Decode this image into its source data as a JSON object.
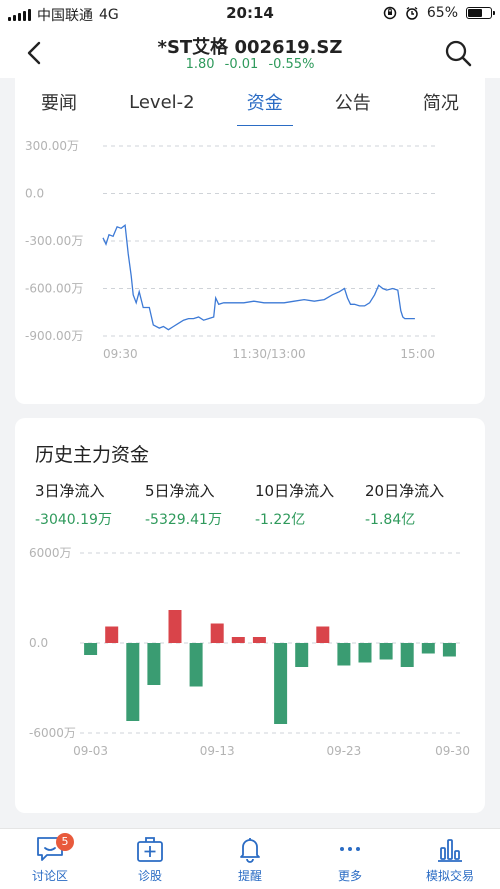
{
  "status_bar": {
    "carrier": "中国联通",
    "network": "4G",
    "time": "20:14",
    "battery": "65%",
    "battery_level": 0.65
  },
  "header": {
    "title": "*ST艾格 002619.SZ",
    "price": "1.80",
    "change": "-0.01",
    "change_pct": "-0.55%"
  },
  "tabs": [
    {
      "label": "要闻",
      "active": false
    },
    {
      "label": "Level-2",
      "active": false
    },
    {
      "label": "资金",
      "active": true
    },
    {
      "label": "公告",
      "active": false
    },
    {
      "label": "简况",
      "active": false
    }
  ],
  "history": {
    "title": "历史主力资金",
    "summary": [
      {
        "label": "3日净流入",
        "value": "-3040.19万"
      },
      {
        "label": "5日净流入",
        "value": "-5329.41万"
      },
      {
        "label": "10日净流入",
        "value": "-1.22亿"
      },
      {
        "label": "20日净流入",
        "value": "-1.84亿"
      }
    ]
  },
  "bottom_nav": [
    {
      "label": "讨论区",
      "icon": "chat-bubble-icon",
      "badge": "5"
    },
    {
      "label": "诊股",
      "icon": "medical-kit-icon"
    },
    {
      "label": "提醒",
      "icon": "bell-icon"
    },
    {
      "label": "更多",
      "icon": "more-dots-icon"
    },
    {
      "label": "模拟交易",
      "icon": "bar-chart-icon"
    }
  ],
  "colors": {
    "accent": "#2b6cc4",
    "down": "#3a9c72",
    "up": "#d9444a"
  },
  "chart_data": [
    {
      "type": "line",
      "y_tick_labels": [
        "300.00万",
        "0.0",
        "-300.00万",
        "-600.00万",
        "-900.00万"
      ],
      "x_tick_labels": [
        "09:30",
        "11:30/13:00",
        "15:00"
      ],
      "ylim": [
        -900,
        300
      ],
      "y_unit": "万",
      "series": [
        {
          "values": [
            [
              0,
              -280
            ],
            [
              3,
              -320
            ],
            [
              6,
              -260
            ],
            [
              10,
              -270
            ],
            [
              14,
              -210
            ],
            [
              18,
              -220
            ],
            [
              22,
              -200
            ],
            [
              25,
              -380
            ],
            [
              28,
              -520
            ],
            [
              30,
              -640
            ],
            [
              33,
              -690
            ],
            [
              36,
              -620
            ],
            [
              40,
              -720
            ],
            [
              46,
              -720
            ],
            [
              50,
              -830
            ],
            [
              56,
              -850
            ],
            [
              60,
              -840
            ],
            [
              65,
              -860
            ],
            [
              70,
              -840
            ],
            [
              75,
              -820
            ],
            [
              80,
              -800
            ],
            [
              85,
              -790
            ],
            [
              90,
              -790
            ],
            [
              95,
              -780
            ],
            [
              100,
              -800
            ],
            [
              105,
              -790
            ],
            [
              110,
              -780
            ],
            [
              112,
              -660
            ],
            [
              115,
              -700
            ],
            [
              120,
              -690
            ],
            [
              130,
              -690
            ],
            [
              140,
              -690
            ],
            [
              150,
              -680
            ],
            [
              160,
              -690
            ],
            [
              170,
              -690
            ],
            [
              180,
              -690
            ],
            [
              190,
              -680
            ],
            [
              200,
              -670
            ],
            [
              210,
              -680
            ],
            [
              220,
              -670
            ],
            [
              228,
              -640
            ],
            [
              235,
              -620
            ],
            [
              240,
              -600
            ],
            [
              243,
              -660
            ],
            [
              246,
              -700
            ],
            [
              250,
              -700
            ],
            [
              255,
              -710
            ],
            [
              260,
              -710
            ],
            [
              265,
              -690
            ],
            [
              270,
              -640
            ],
            [
              274,
              -580
            ],
            [
              278,
              -600
            ],
            [
              282,
              -610
            ],
            [
              288,
              -600
            ],
            [
              293,
              -610
            ],
            [
              296,
              -740
            ],
            [
              298,
              -780
            ],
            [
              300,
              -790
            ],
            [
              310,
              -790
            ]
          ]
        }
      ]
    },
    {
      "type": "bar",
      "y_tick_labels": [
        "6000万",
        "0.0",
        "-6000万"
      ],
      "x_tick_labels": [
        "09-03",
        "09-13",
        "09-23",
        "09-30"
      ],
      "ylim": [
        -6000,
        6000
      ],
      "y_unit": "万",
      "values": [
        -800,
        1100,
        -5200,
        -2800,
        2200,
        -2900,
        1300,
        400,
        400,
        -5400,
        -1600,
        1100,
        -1500,
        -1300,
        -1100,
        -1600,
        -700,
        -900
      ]
    }
  ]
}
